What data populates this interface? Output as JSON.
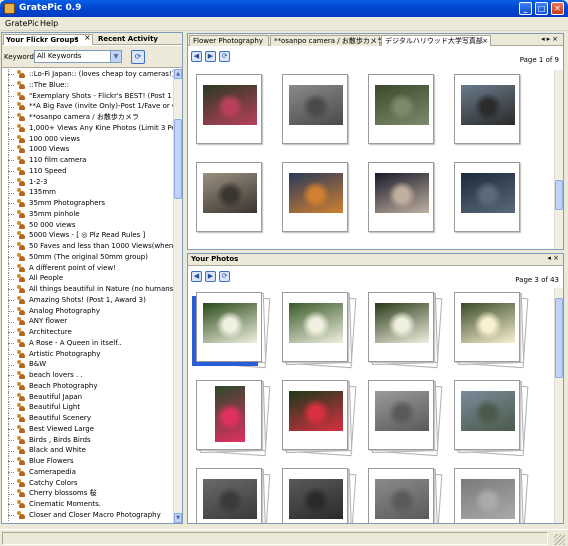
{
  "window": {
    "title": "GratePic 0.9"
  },
  "menu": [
    "GratePic",
    "Help"
  ],
  "left_panel": {
    "tabs": [
      "Your Flickr Groups",
      "Recent Activity"
    ],
    "keyword_label": "Keyword",
    "keyword_value": "All Keywords",
    "groups": [
      "::Lo-Fi Japan:: (loves cheap toy cameras!)",
      "::The Blue::",
      "\"Exemplary Shots - Flickr's BEST! (Post 1 Aw",
      "**A Big Fave (invite Only)-Post 1/Fave or Co",
      "**osanpo camera / お散歩カメラ",
      "1,000+ Views Any Kine Photos (Limit 3 Per Da",
      "100 000 views",
      "1000 Views",
      "110 film camera",
      "110 Speed",
      "1-2-3",
      "135mm",
      "35mm Photographers",
      "35mm pinhole",
      "50 000 views",
      "5000 Views - [ ◎ Plz Read Rules ]",
      "50 Faves and less than 1000 Views(when post",
      "50mm (The original 50mm group)",
      "A different point of view!",
      "All People",
      "All things beautiful in Nature (no humans or m",
      "Amazing Shots! (Post 1, Award 3)",
      "Analog Photography",
      "ANY flower",
      "Architecture",
      "A Rose - A Queen in itself..",
      "Artistic Photography",
      "B&W",
      "beach lovers . .",
      "Beach Photography",
      "Beautiful Japan",
      "Beautiful Light",
      "Beautiful Scenery",
      "Best Viewed Large",
      "Birds , Birds Birds",
      "Black and White",
      "Blue Flowers",
      "Camerapedia",
      "Catchy Colors",
      "Cherry blossoms  桜",
      "Cinematic Moments.",
      "Closer and Closer Macro Photography"
    ]
  },
  "top_pane": {
    "tabs": [
      "Flower Photography",
      "**osanpo camera / お散歩カメラ",
      "デジタルハリウッド大学写真部"
    ],
    "page_indicator": "Page 1 of 9",
    "photos": [
      {
        "c1": "#2a3a22",
        "c2": "#b8405a"
      },
      {
        "c1": "#8a8a8a",
        "c2": "#4a4a4a"
      },
      {
        "c1": "#3a4a2a",
        "c2": "#7a8a6a"
      },
      {
        "c1": "#6a7a8a",
        "c2": "#2a2a2a"
      },
      {
        "c1": "#9a9080",
        "c2": "#3a3530"
      },
      {
        "c1": "#2a3a5a",
        "c2": "#d08030"
      },
      {
        "c1": "#1a1a2a",
        "c2": "#c0b0a0"
      },
      {
        "c1": "#1a2a3a",
        "c2": "#5a6a7a"
      }
    ]
  },
  "bottom_pane": {
    "title": "Your Photos",
    "page_indicator": "Page 3 of 43",
    "photos": [
      {
        "c1": "#2a4a1a",
        "c2": "#f0f0e0",
        "portrait": false
      },
      {
        "c1": "#3a5a2a",
        "c2": "#f0f0e0",
        "portrait": false
      },
      {
        "c1": "#2a3a1a",
        "c2": "#f0f0e0",
        "portrait": false
      },
      {
        "c1": "#3a4a2a",
        "c2": "#f8f0d0",
        "portrait": false
      },
      {
        "c1": "#2a4a2a",
        "c2": "#e03060",
        "portrait": true
      },
      {
        "c1": "#1a3a1a",
        "c2": "#d83040",
        "portrait": false
      },
      {
        "c1": "#9a9a9a",
        "c2": "#5a5a5a",
        "portrait": false
      },
      {
        "c1": "#7a8a9a",
        "c2": "#4a5a4a",
        "portrait": false
      },
      {
        "c1": "#6a6a6a",
        "c2": "#3a3a3a",
        "portrait": false
      },
      {
        "c1": "#5a5a5a",
        "c2": "#2a2a2a",
        "portrait": false
      },
      {
        "c1": "#8a8a8a",
        "c2": "#5a5a5a",
        "portrait": false
      },
      {
        "c1": "#7a7a7a",
        "c2": "#aaaaaa",
        "portrait": false
      }
    ]
  }
}
